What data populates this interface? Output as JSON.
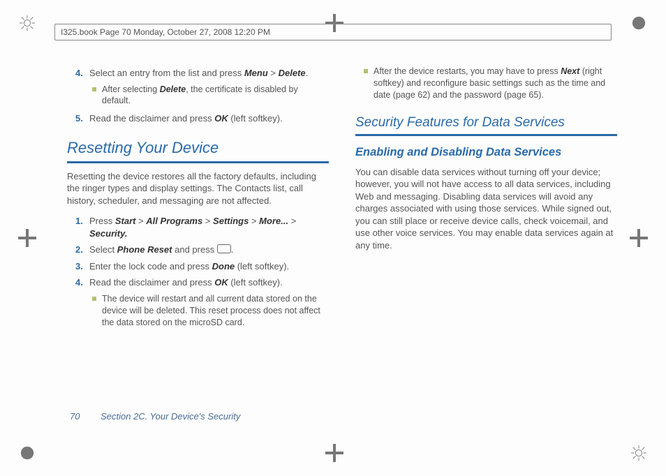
{
  "header_line": "I325.book  Page 70  Monday, October 27, 2008  12:20 PM",
  "left": {
    "step4_pre": "Select an entry from the list and press ",
    "step4_b1": "Menu",
    "step4_gt": " > ",
    "step4_b2": "Delete",
    "step4_post": ".",
    "note4_pre": "After selecting ",
    "note4_b": "Delete",
    "note4_post": ", the certificate is disabled by default.",
    "step5_pre": "Read the disclaimer and press ",
    "step5_b": "OK",
    "step5_post": " (left softkey).",
    "h1": "Resetting Your Device",
    "intro": "Resetting the device restores all the factory defaults, including the ringer types and display settings. The Contacts list, call history, scheduler, and messaging are not affected.",
    "r1_pre": "Press ",
    "r1_b1": "Start",
    "gt": " > ",
    "r1_b2": "All Programs",
    "r1_b3": "Settings",
    "r1_b4": "More...",
    "r1_b5": "Security.",
    "r2_pre": " Select ",
    "r2_b": "Phone Reset",
    "r2_mid": " and press ",
    "r2_post": ".",
    "r3_pre": "Enter the lock code and press ",
    "r3_b": "Done",
    "r3_post": " (left softkey).",
    "r4_pre": "Read the disclaimer and press ",
    "r4_b": "OK",
    "r4_post": " (left softkey).",
    "rnote": "The device will restart and all current data stored on the device will be deleted. This reset process does not affect the data stored on the microSD card."
  },
  "right": {
    "note_pre": "After the device restarts, you may have to press ",
    "note_b": "Next",
    "note_post": " (right softkey) and reconfigure basic settings such as the time and date (page 62) and the password (page 65).",
    "h1": "Security Features for Data Services",
    "h2": "Enabling and Disabling Data Services",
    "para": "You can disable data services without turning off your device; however, you will not have access to all data services, including Web and messaging. Disabling data services will avoid any charges associated with using those services. While signed out, you can still place or receive device calls, check voicemail, and use other voice services. You may enable data services again at any time."
  },
  "footer": {
    "page": "70",
    "section": "Section 2C. Your Device's Security"
  },
  "nums": {
    "n1": "1.",
    "n2": "2.",
    "n3": "3.",
    "n4": "4.",
    "n5": "5."
  }
}
